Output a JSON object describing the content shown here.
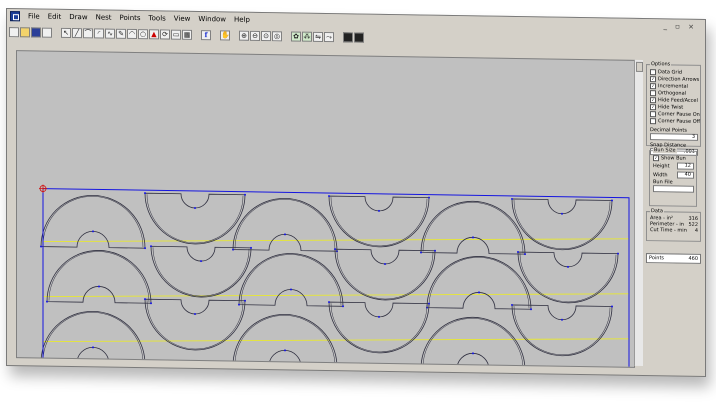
{
  "menu": {
    "items": [
      "File",
      "Edit",
      "Draw",
      "Nest",
      "Points",
      "Tools",
      "View",
      "Window",
      "Help"
    ],
    "window_controls": "_ ▫ ×"
  },
  "toolbar": {
    "f_label": "f"
  },
  "options": {
    "title": "Options",
    "items": [
      {
        "label": "Data Grid",
        "checked": false
      },
      {
        "label": "Direction Arrows",
        "checked": true
      },
      {
        "label": "Incremental",
        "checked": true
      },
      {
        "label": "Orthogonal",
        "checked": false
      },
      {
        "label": "Hide Feed/Accel",
        "checked": true
      },
      {
        "label": "Hide Twist",
        "checked": true
      },
      {
        "label": "Corner Pause On",
        "checked": false
      },
      {
        "label": "Corner Pause Off",
        "checked": false
      }
    ],
    "decimal_points_label": "Decimal Points",
    "decimal_points_value": "3",
    "snap_distance_label": "Snap Distance",
    "snap_distance_value": ".001",
    "bun": {
      "title": "Bun Size",
      "show_bun_label": "Show Bun",
      "show_bun_checked": true,
      "height_label": "Height",
      "height_value": "12",
      "width_label": "Width",
      "width_value": "40",
      "bun_file_label": "Bun File",
      "bun_file_value": ""
    }
  },
  "data": {
    "title": "Data",
    "rows": [
      {
        "label": "Area - in²",
        "value": "316"
      },
      {
        "label": "Perimeter - in",
        "value": "522"
      },
      {
        "label": "Cut Time - min",
        "value": "4"
      }
    ]
  },
  "points": {
    "label": "Points",
    "value": "460"
  },
  "colors": {
    "canvas_bg": "#c0c0c0",
    "bun_border": "#1515e0",
    "yellow_lines": "#e8e830",
    "shape_stroke": "#303040"
  }
}
